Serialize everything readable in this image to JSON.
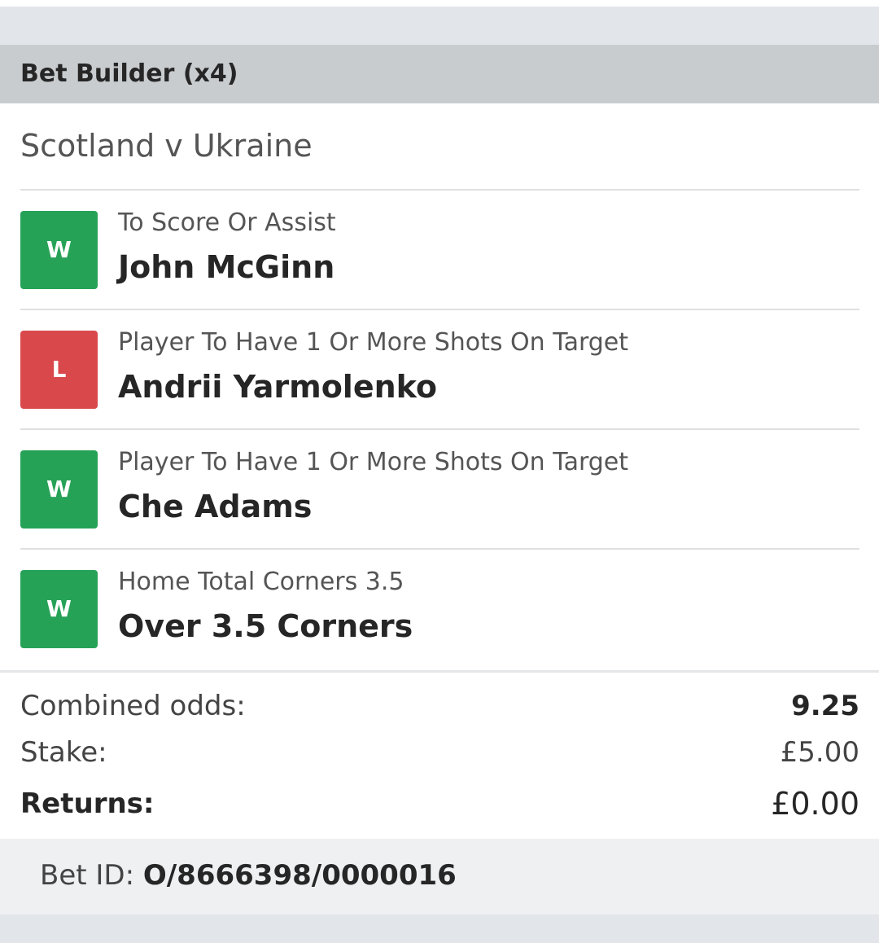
{
  "header": {
    "title": "Bet Builder (x4)"
  },
  "match": {
    "title": "Scotland v Ukraine"
  },
  "legs": [
    {
      "result": "W",
      "status": "win",
      "market": "To Score Or Assist",
      "selection": "John McGinn"
    },
    {
      "result": "L",
      "status": "lose",
      "market": "Player To Have 1 Or More Shots On Target",
      "selection": "Andrii Yarmolenko"
    },
    {
      "result": "W",
      "status": "win",
      "market": "Player To Have 1 Or More Shots On Target",
      "selection": "Che Adams"
    },
    {
      "result": "W",
      "status": "win",
      "market": "Home Total Corners 3.5",
      "selection": "Over 3.5 Corners"
    }
  ],
  "summary": {
    "combined_odds_label": "Combined odds:",
    "combined_odds_value": "9.25",
    "stake_label": "Stake:",
    "stake_value": "£5.00",
    "returns_label": "Returns:",
    "returns_value": "£0.00"
  },
  "bet": {
    "id_label": "Bet ID:",
    "id_value": "O/8666398/0000016"
  },
  "colors": {
    "win": "#26a257",
    "lose": "#d9494c",
    "header_bg": "#c9cccf",
    "page_bg": "#e2e6ea"
  }
}
